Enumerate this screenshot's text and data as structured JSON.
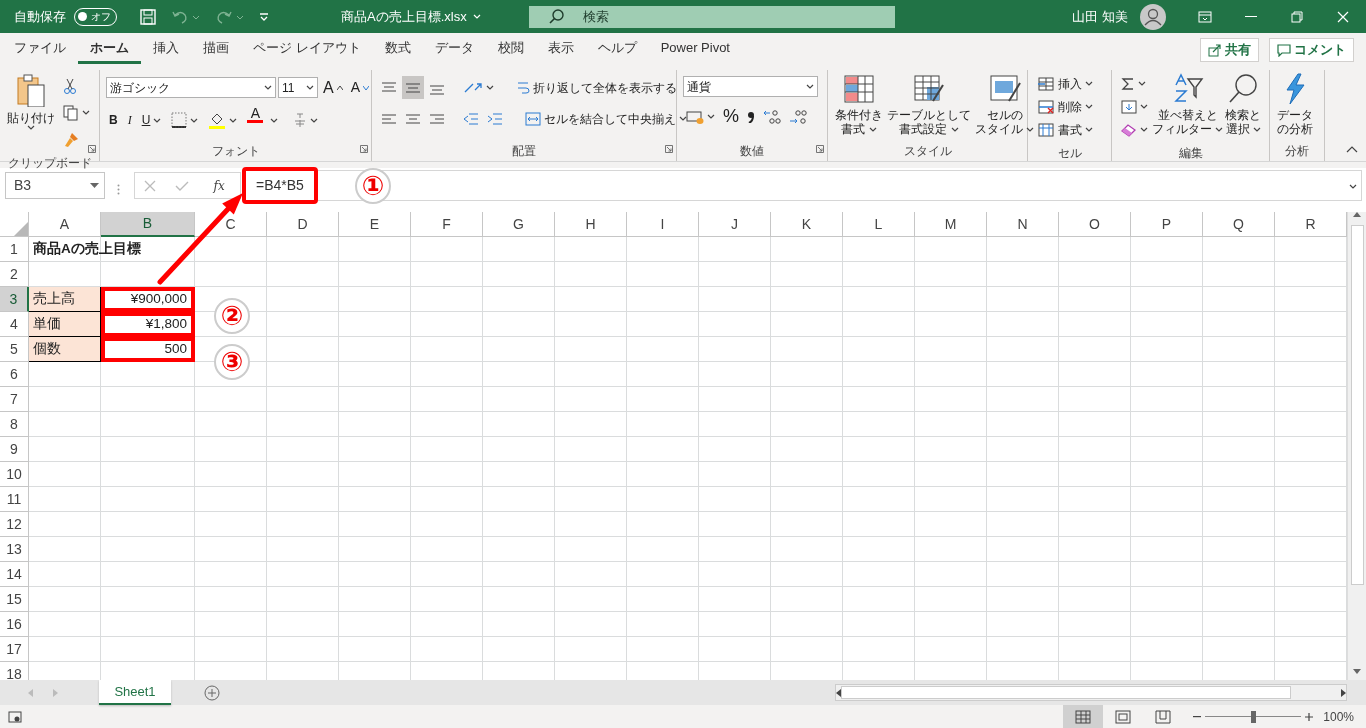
{
  "title_bar": {
    "autosave_label": "自動保存",
    "autosave_toggle": {
      "text": "オフ",
      "on": false
    },
    "file_name": "商品Aの売上目標.xlsx",
    "search": {
      "placeholder": "検索"
    },
    "user_name": "山田 知美"
  },
  "ribbon_tabs": [
    {
      "label": "ファイル",
      "selected": false
    },
    {
      "label": "ホーム",
      "selected": true
    },
    {
      "label": "挿入",
      "selected": false
    },
    {
      "label": "描画",
      "selected": false
    },
    {
      "label": "ページ レイアウト",
      "selected": false
    },
    {
      "label": "数式",
      "selected": false
    },
    {
      "label": "データ",
      "selected": false
    },
    {
      "label": "校閲",
      "selected": false
    },
    {
      "label": "表示",
      "selected": false
    },
    {
      "label": "ヘルプ",
      "selected": false
    },
    {
      "label": "Power Pivot",
      "selected": false
    }
  ],
  "ribbon_actions": [
    {
      "kind": "share",
      "label": "共有"
    },
    {
      "kind": "comment",
      "label": "コメント"
    }
  ],
  "ribbon": {
    "clipboard": {
      "paste": "貼り付け",
      "label": "クリップボード"
    },
    "font": {
      "font_name": "游ゴシック",
      "font_size": "11",
      "grow": "A",
      "shrink": "A",
      "bold": "B",
      "italic": "I",
      "underline": "U",
      "font_color": "A",
      "label": "フォント"
    },
    "alignment": {
      "wrap_text": "折り返して全体を表示する",
      "merge_center": "セルを結合して中央揃え",
      "label": "配置"
    },
    "number": {
      "format": "通貨",
      "percent": "%",
      "label": "数値"
    },
    "styles": {
      "buttons": [
        [
          "条件付き",
          "書式"
        ],
        [
          "テーブルとして",
          "書式設定"
        ],
        [
          "セルの",
          "スタイル"
        ]
      ],
      "label": "スタイル"
    },
    "cells": {
      "buttons": [
        "挿入",
        "削除",
        "書式"
      ],
      "label": "セル"
    },
    "editing": {
      "buttons": [
        [
          "並べ替えと",
          "フィルター"
        ],
        [
          "検索と",
          "選択"
        ]
      ],
      "label": "編集"
    },
    "analysis": {
      "button": [
        "データ",
        "の分析"
      ],
      "label": "分析"
    }
  },
  "formula_bar": {
    "name_box": "B3",
    "fx": "fx",
    "formula": "=B4*B5",
    "highlighted": true
  },
  "columns": [
    {
      "label": "A",
      "selected": false
    },
    {
      "label": "B",
      "selected": true
    },
    {
      "label": "C",
      "selected": false
    },
    {
      "label": "D",
      "selected": false
    },
    {
      "label": "E",
      "selected": false
    },
    {
      "label": "F",
      "selected": false
    },
    {
      "label": "G",
      "selected": false
    },
    {
      "label": "H",
      "selected": false
    },
    {
      "label": "I",
      "selected": false
    },
    {
      "label": "J",
      "selected": false
    },
    {
      "label": "K",
      "selected": false
    },
    {
      "label": "L",
      "selected": false
    },
    {
      "label": "M",
      "selected": false
    },
    {
      "label": "N",
      "selected": false
    },
    {
      "label": "O",
      "selected": false
    },
    {
      "label": "P",
      "selected": false
    },
    {
      "label": "Q",
      "selected": false
    },
    {
      "label": "R",
      "selected": false
    }
  ],
  "rows": [
    {
      "label": "1",
      "selected": false,
      "cells": [
        {
          "kind": "title",
          "text": "商品Aの売上目標"
        }
      ]
    },
    {
      "label": "2",
      "selected": false
    },
    {
      "label": "3",
      "selected": true,
      "cells": [
        {
          "kind": "label",
          "text": "売上高"
        },
        {
          "kind": "number",
          "text": "¥900,000",
          "highlighted": true
        }
      ]
    },
    {
      "label": "4",
      "selected": false,
      "cells": [
        {
          "kind": "label",
          "text": "単価"
        },
        {
          "kind": "number",
          "text": "¥1,800",
          "highlighted": true
        }
      ]
    },
    {
      "label": "5",
      "selected": false,
      "cells": [
        {
          "kind": "label",
          "text": "個数"
        },
        {
          "kind": "number",
          "text": "500",
          "highlighted": true
        }
      ]
    },
    {
      "label": "6",
      "selected": false
    },
    {
      "label": "7",
      "selected": false
    },
    {
      "label": "8",
      "selected": false
    },
    {
      "label": "9",
      "selected": false
    },
    {
      "label": "10",
      "selected": false
    },
    {
      "label": "11",
      "selected": false
    },
    {
      "label": "12",
      "selected": false
    },
    {
      "label": "13",
      "selected": false
    },
    {
      "label": "14",
      "selected": false
    },
    {
      "label": "15",
      "selected": false
    },
    {
      "label": "16",
      "selected": false
    },
    {
      "label": "17",
      "selected": false
    },
    {
      "label": "18",
      "selected": false
    }
  ],
  "annotations": [
    {
      "kind": "callout",
      "text": "①"
    },
    {
      "kind": "callout",
      "text": "②"
    },
    {
      "kind": "callout",
      "text": "③"
    }
  ],
  "sheet_tabs": [
    {
      "label": "Sheet1",
      "selected": true
    }
  ],
  "status_bar": {
    "views": [
      {
        "kind": "normal",
        "selected": true
      },
      {
        "kind": "page_layout",
        "selected": false
      },
      {
        "kind": "page_break",
        "selected": false
      }
    ],
    "zoom_slider": {
      "level": 0.5
    },
    "zoom": "100%"
  }
}
